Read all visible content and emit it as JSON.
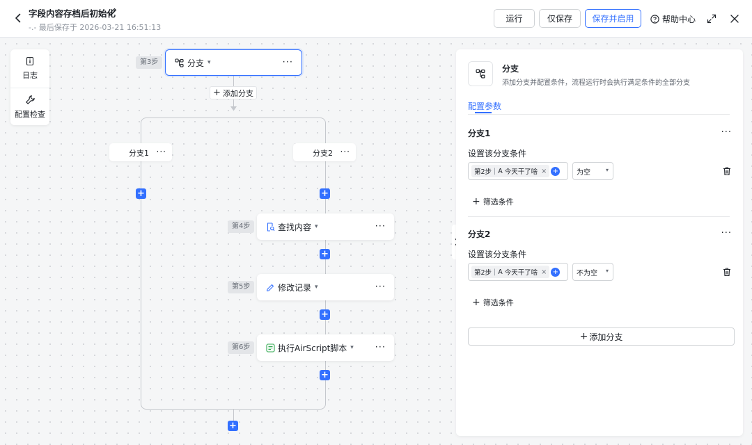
{
  "header": {
    "title": "字段内容存档后初始化",
    "saved_text": "-.- 最后保存于 2026-03-21 16:51:13",
    "buttons": {
      "run": "运行",
      "save_only": "仅保存",
      "save_enable": "保存并启用"
    },
    "help": "帮助中心"
  },
  "toolbox": {
    "log": "日志",
    "config_check": "配置检查"
  },
  "flow": {
    "step3": {
      "tag": "第3步",
      "label": "分支"
    },
    "add_branch": "添加分支",
    "branch1": "分支1",
    "branch2": "分支2",
    "step4": {
      "tag": "第4步",
      "label": "查找内容"
    },
    "step5": {
      "tag": "第5步",
      "label": "修改记录"
    },
    "step6": {
      "tag": "第6步",
      "label": "执行AirScript脚本"
    },
    "more": "···",
    "plus": "+"
  },
  "panel": {
    "title": "分支",
    "description": "添加分支并配置条件，流程运行时会执行满足条件的全部分支",
    "tab": "配置参数",
    "branches": [
      {
        "name": "分支1",
        "sub": "设置该分支条件",
        "chip_step": "第2步",
        "chip_field": "今天干了啥",
        "operator": "为空",
        "filter": "筛选条件"
      },
      {
        "name": "分支2",
        "sub": "设置该分支条件",
        "chip_step": "第2步",
        "chip_field": "今天干了啥",
        "operator": "不为空",
        "filter": "筛选条件"
      }
    ],
    "add_branch": "添加分支"
  },
  "colors": {
    "accent": "#3370ff",
    "text": "#1f2329",
    "muted": "#8f959e"
  },
  "icons": [
    "back-arrow-icon",
    "pencil-icon",
    "help-circle-icon",
    "expand-icon",
    "close-icon",
    "info-doc-icon",
    "wrench-icon",
    "branch-icon",
    "search-doc-icon",
    "edit-pen-icon",
    "script-icon",
    "chevron-down-icon",
    "trash-icon",
    "plus-icon",
    "chevron-right-icon",
    "text-field-icon"
  ]
}
